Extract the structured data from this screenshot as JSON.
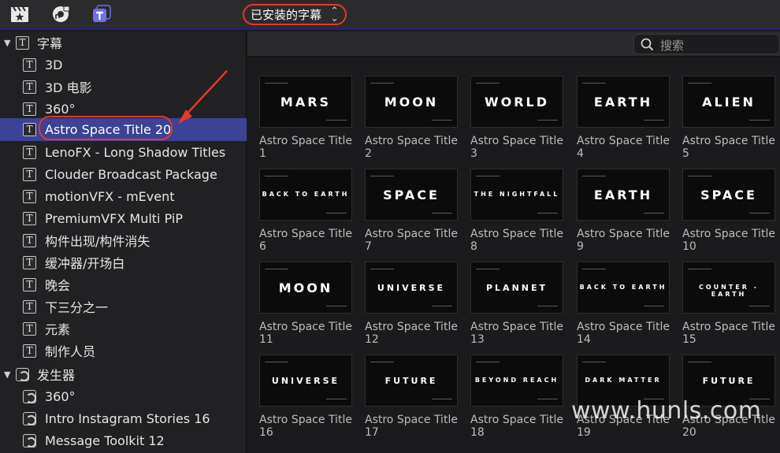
{
  "toolbar": {
    "icons": [
      "clapper-star-icon",
      "music-camera-icon",
      "titles-generators-icon"
    ],
    "library_dropdown": "已安装的字幕",
    "accent": "#e23a2a"
  },
  "sidebar": {
    "section_titles": "字幕",
    "titles": [
      "3D",
      "3D 电影",
      "360°",
      "Astro Space Title 20",
      "LenoFX - Long Shadow Titles",
      "Clouder Broadcast Package",
      "motionVFX - mEvent",
      "PremiumVFX Multi PiP",
      "构件出现/构件消失",
      "缓冲器/开场白",
      "晚会",
      "下三分之一",
      "元素",
      "制作人员"
    ],
    "selected": "Astro Space Title 20",
    "section_generators": "发生器",
    "generators": [
      "360°",
      "Intro Instagram Stories 16",
      "Message Toolkit 12"
    ]
  },
  "search": {
    "placeholder": "搜索"
  },
  "grid": {
    "items": [
      {
        "name": "Astro Space Title",
        "num": "1",
        "art": "MARS"
      },
      {
        "name": "Astro Space Title",
        "num": "2",
        "art": "MOON"
      },
      {
        "name": "Astro Space Title",
        "num": "3",
        "art": "WORLD"
      },
      {
        "name": "Astro Space Title",
        "num": "4",
        "art": "EARTH"
      },
      {
        "name": "Astro Space Title",
        "num": "5",
        "art": "ALIEN"
      },
      {
        "name": "Astro Space Title",
        "num": "6",
        "art": "BACK TO EARTH"
      },
      {
        "name": "Astro Space Title",
        "num": "7",
        "art": "SPACE"
      },
      {
        "name": "Astro Space Title",
        "num": "8",
        "art": "THE NIGHTFALL"
      },
      {
        "name": "Astro Space Title",
        "num": "9",
        "art": "EARTH"
      },
      {
        "name": "Astro Space Title",
        "num": "10",
        "art": "SPACE"
      },
      {
        "name": "Astro Space Title",
        "num": "11",
        "art": "MOON"
      },
      {
        "name": "Astro Space Title",
        "num": "12",
        "art": "UNIVERSE"
      },
      {
        "name": "Astro Space Title",
        "num": "13",
        "art": "PLANNET"
      },
      {
        "name": "Astro Space Title",
        "num": "14",
        "art": "BACK TO EARTH"
      },
      {
        "name": "Astro Space Title",
        "num": "15",
        "art": "COUNTER - EARTH"
      },
      {
        "name": "Astro Space Title",
        "num": "16",
        "art": "UNIVERSE"
      },
      {
        "name": "Astro Space Title",
        "num": "17",
        "art": "FUTURE"
      },
      {
        "name": "Astro Space Title",
        "num": "18",
        "art": "BEYOND REACH"
      },
      {
        "name": "Astro Space Title",
        "num": "19",
        "art": "DARK MATTER"
      },
      {
        "name": "Astro Space Title",
        "num": "20",
        "art": "FUTURE"
      }
    ]
  },
  "watermark": "www.hunls.com",
  "colors": {
    "selection": "#3c4294",
    "highlight": "#e23a2a",
    "background": "#1b1b1d"
  }
}
